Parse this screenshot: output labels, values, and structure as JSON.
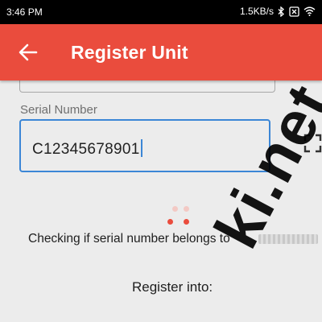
{
  "status_bar": {
    "time": "3:46 PM",
    "network_speed": "1.5KB/s",
    "icons": [
      "bluetooth-icon",
      "no-sim-icon",
      "wifi-icon"
    ]
  },
  "app_bar": {
    "title": "Register Unit",
    "back_icon": "arrow-left-icon",
    "background_color": "#ea4c3d"
  },
  "form": {
    "serial_label": "Serial Number",
    "serial_value": "C12345678901",
    "scan_icon": "scan-frame-icon",
    "focus_color": "#3b86d6"
  },
  "loading": {
    "dot_colors": [
      "#f3c9c4",
      "#f3c9c4",
      "#ea4c3d",
      "#ea4c3d"
    ],
    "checking_text": "Checking if serial number belongs to"
  },
  "register_into_label": "Register into:",
  "watermark_text": "ki.net"
}
